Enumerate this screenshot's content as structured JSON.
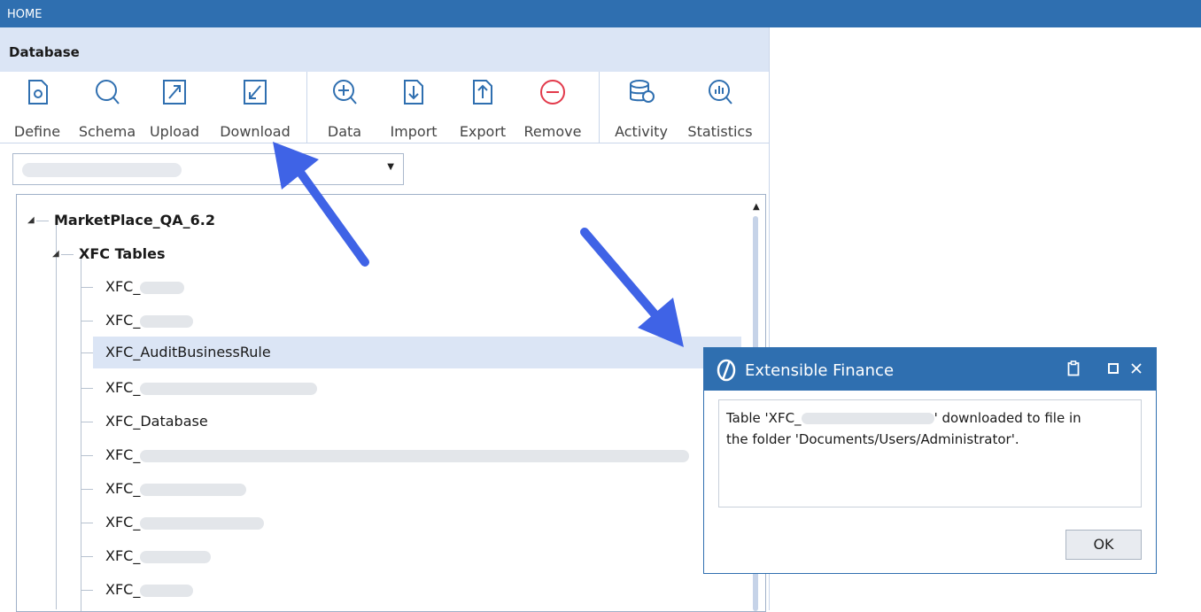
{
  "topbar": {
    "title": "HOME"
  },
  "database_panel": {
    "title": "Database",
    "ribbon": {
      "buttons": [
        {
          "label": "Define"
        },
        {
          "label": "Schema"
        },
        {
          "label": "Upload"
        },
        {
          "label": "Download"
        },
        {
          "label": "Data"
        },
        {
          "label": "Import"
        },
        {
          "label": "Export"
        },
        {
          "label": "Remove"
        },
        {
          "label": "Activity"
        },
        {
          "label": "Statistics"
        }
      ]
    },
    "app_selector": {
      "value": ""
    }
  },
  "tree": {
    "root": "MarketPlace_QA_6.2",
    "group": "XFC Tables",
    "items": [
      "XFC_",
      "XFC_",
      "XFC_AuditBusinessRule",
      "XFC_",
      "XFC_Database",
      "XFC_",
      "XFC_",
      "XFC_",
      "XFC_",
      "XFC_"
    ],
    "selected_index": 2
  },
  "dialog": {
    "title": "Extensible Finance",
    "message_part1": "Table 'XFC_",
    "message_part2": "' downloaded to file in",
    "message_line2": "the folder 'Documents/Users/Administrator'.",
    "ok_label": "OK"
  },
  "colors": {
    "accent": "#2f6fb0",
    "header_bg": "#dbe5f5",
    "annotation_arrow": "#3f63e6",
    "remove_icon": "#e23a4b"
  }
}
